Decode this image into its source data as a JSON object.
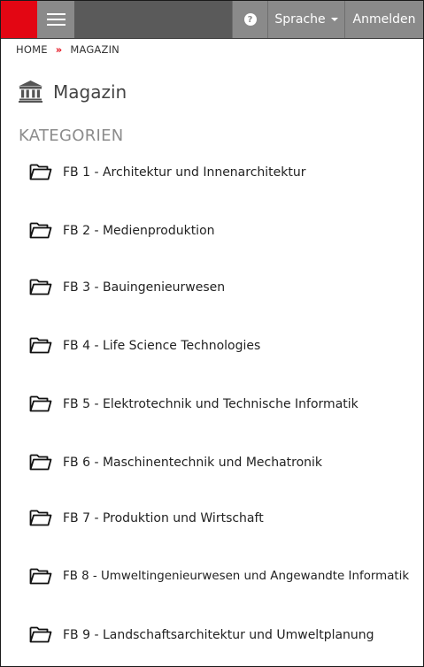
{
  "header": {
    "help_icon_glyph": "?",
    "language_label": "Sprache",
    "login_label": "Anmelden",
    "brand_color": "#e30613"
  },
  "breadcrumb": {
    "items": [
      "HOME",
      "MAGAZIN"
    ],
    "separator": "»"
  },
  "page": {
    "title": "Magazin",
    "title_icon": "bank-building-icon"
  },
  "categories": {
    "heading": "KATEGORIEN",
    "item_icon": "folder-open-icon",
    "items": [
      "FB 1 - Architektur und Innenarchitektur",
      "FB 2 - Medienproduktion",
      "FB 3 - Bauingenieurwesen",
      "FB 4 - Life Science Technologies",
      "FB 5 - Elektrotechnik und Technische Informatik",
      "FB 6 - Maschinentechnik und Mechatronik",
      "FB 7 - Produktion und Wirtschaft",
      "FB 8 - Umweltingenieurwesen und Angewandte Informatik",
      "FB 9 - Landschaftsarchitektur und Umweltplanung"
    ]
  }
}
